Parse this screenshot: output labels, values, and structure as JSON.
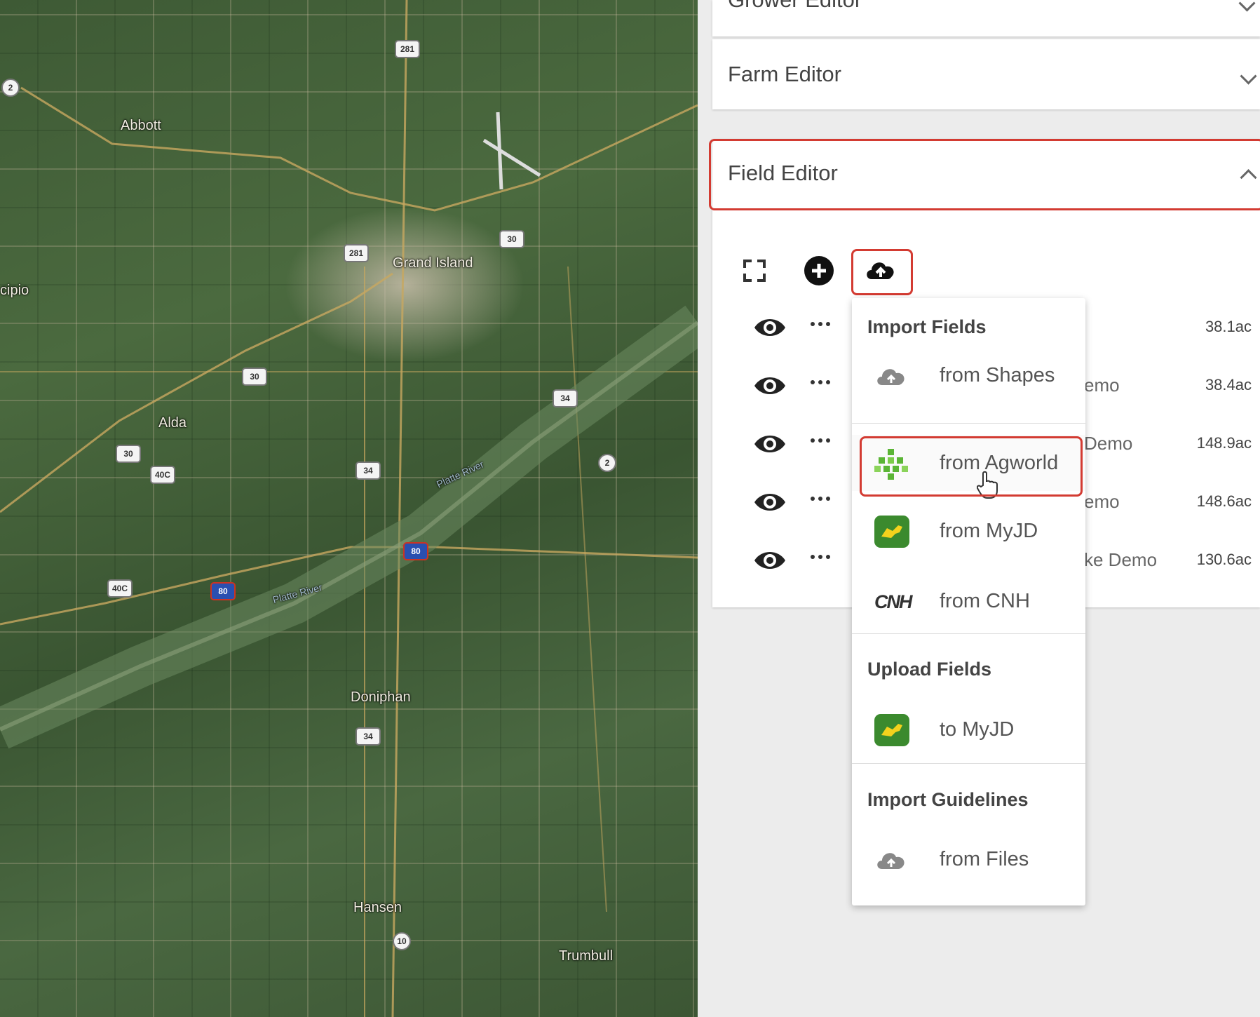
{
  "map": {
    "towns": [
      "Abbott",
      "Grand Island",
      "Alda",
      "Doniphan",
      "Hansen",
      "Trumbull"
    ],
    "partial_labels": [
      "cipio"
    ],
    "shields": [
      "2",
      "281",
      "281",
      "30",
      "30",
      "34",
      "30",
      "40C",
      "34",
      "2",
      "80",
      "40C",
      "80",
      "34",
      "10"
    ],
    "river_labels": [
      "Platte River",
      "Platte River"
    ]
  },
  "panel": {
    "grower_editor": "Grower Editor",
    "farm_editor": "Farm Editor",
    "field_editor": "Field Editor"
  },
  "toolbar": {
    "icons": [
      "fullscreen-icon",
      "add-circle-icon",
      "cloud-upload-icon"
    ]
  },
  "fields": [
    {
      "name": "",
      "area": "38.1ac"
    },
    {
      "name": "emo",
      "area": "38.4ac"
    },
    {
      "name": "Demo",
      "area": "148.9ac"
    },
    {
      "name": "emo",
      "area": "148.6ac"
    },
    {
      "name": "ke Demo",
      "area": "130.6ac"
    }
  ],
  "import_menu": {
    "import_fields_title": "Import Fields",
    "from_shapes": "from Shapes",
    "from_agworld": "from Agworld",
    "from_myjd": "from MyJD",
    "from_cnh": "from CNH",
    "upload_fields_title": "Upload Fields",
    "to_myjd": "to MyJD",
    "import_guidelines_title": "Import Guidelines",
    "from_files": "from Files",
    "cnh_logo": "CNH"
  },
  "colors": {
    "highlight": "#d33b32",
    "agworld_green": "#5bb536",
    "john_deere_green": "#3b8a2e",
    "john_deere_yellow": "#f4d21d"
  }
}
